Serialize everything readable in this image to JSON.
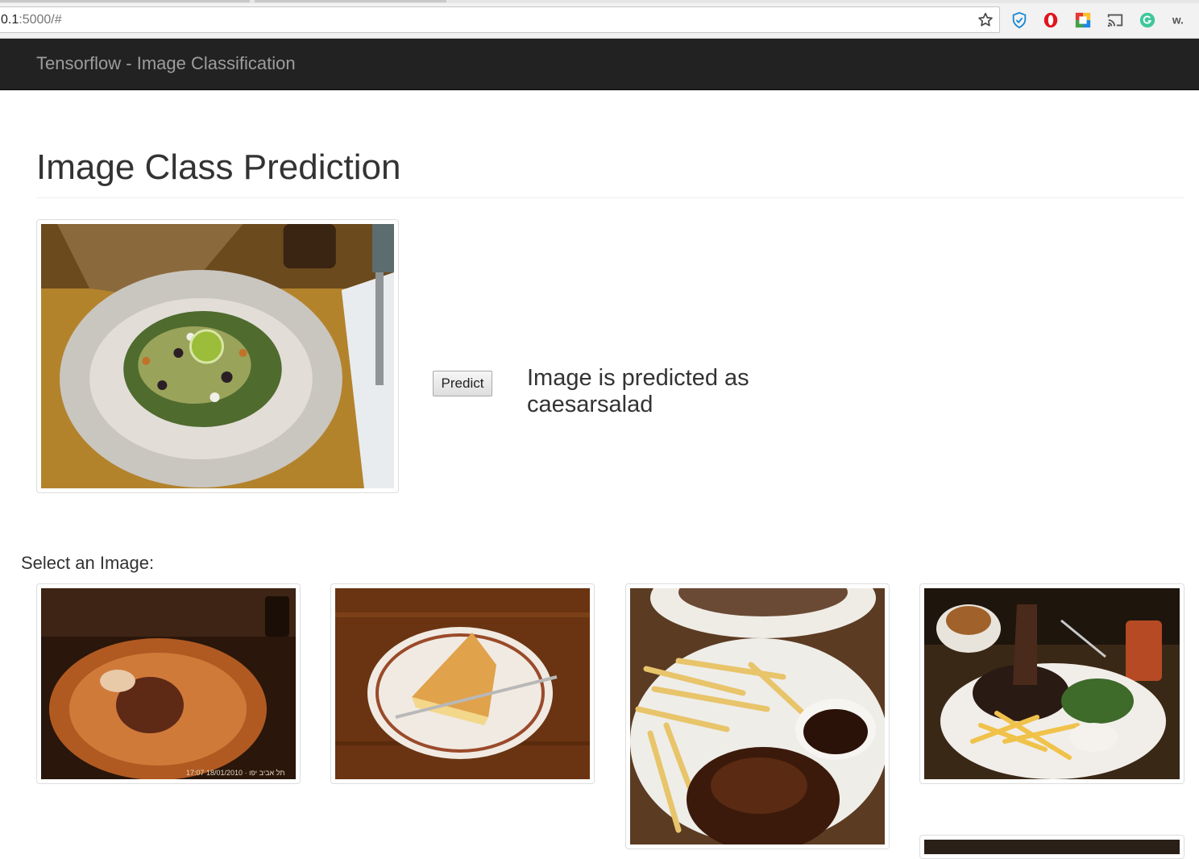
{
  "browser": {
    "url_host": "0.1",
    "url_path": ":5000/#",
    "extension_icons": [
      "shield-check-icon",
      "opera-icon",
      "color-picker-icon",
      "cast-icon",
      "grammarly-icon",
      "wappalyzer-icon"
    ]
  },
  "navbar": {
    "brand": "Tensorflow - Image Classification"
  },
  "main": {
    "title": "Image Class Prediction",
    "predict_label": "Predict",
    "result_text": "Image is predicted as caesarsalad",
    "select_label": "Select an Image:",
    "preview_image": "caesar-salad-photo",
    "gallery": [
      {
        "name": "dessert-plate-photo",
        "caption": "17:07 18/01/2010 · תל אביב יפו"
      },
      {
        "name": "pie-slice-photo"
      },
      {
        "name": "ribs-fries-photo"
      },
      {
        "name": "steak-fries-salad-photo"
      }
    ]
  },
  "colors": {
    "navbar_bg": "#222222",
    "brand_text": "#9d9d9d",
    "page_bg": "#ffffff"
  }
}
